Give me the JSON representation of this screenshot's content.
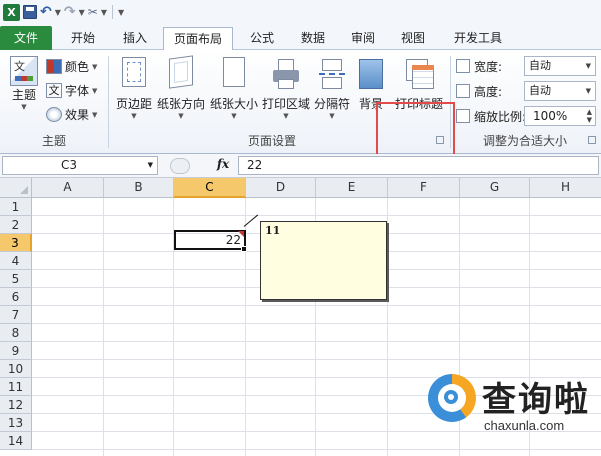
{
  "quick_access": {
    "icons": [
      "excel-icon",
      "save-icon",
      "undo-icon",
      "redo-icon",
      "customize-icon"
    ]
  },
  "tabs": [
    {
      "label": "文件"
    },
    {
      "label": "开始"
    },
    {
      "label": "插入"
    },
    {
      "label": "页面布局",
      "active": true
    },
    {
      "label": "公式"
    },
    {
      "label": "数据"
    },
    {
      "label": "审阅"
    },
    {
      "label": "视图"
    },
    {
      "label": "开发工具"
    }
  ],
  "ribbon": {
    "theme_group": {
      "label": "主题",
      "theme_button": "主题",
      "colors": "颜色",
      "fonts": "字体",
      "effects": "效果"
    },
    "page_setup_group": {
      "label": "页面设置",
      "margins": "页边距",
      "orientation": "纸张方向",
      "size": "纸张大小",
      "print_area": "打印区域",
      "breaks": "分隔符",
      "background": "背景",
      "print_titles": "打印标题"
    },
    "scale_group": {
      "label": "调整为合适大小",
      "width_label": "宽度:",
      "width_value": "自动",
      "height_label": "高度:",
      "height_value": "自动",
      "scale_label": "缩放比例:",
      "scale_value": "100%"
    },
    "highlight_color": "#e34a4a"
  },
  "formula_bar": {
    "name_box": "C3",
    "fx": "fx",
    "value": "22"
  },
  "sheet": {
    "columns": [
      "A",
      "B",
      "C",
      "D",
      "E",
      "F",
      "G",
      "H"
    ],
    "rows": [
      "1",
      "2",
      "3",
      "4",
      "5",
      "6",
      "7",
      "8",
      "9",
      "10",
      "11",
      "12",
      "13",
      "14"
    ],
    "selected_cell": {
      "ref": "C3",
      "value": "22"
    },
    "comment": {
      "text": "11"
    }
  },
  "watermark": {
    "title": "查询啦",
    "url": "chaxunla.com"
  }
}
